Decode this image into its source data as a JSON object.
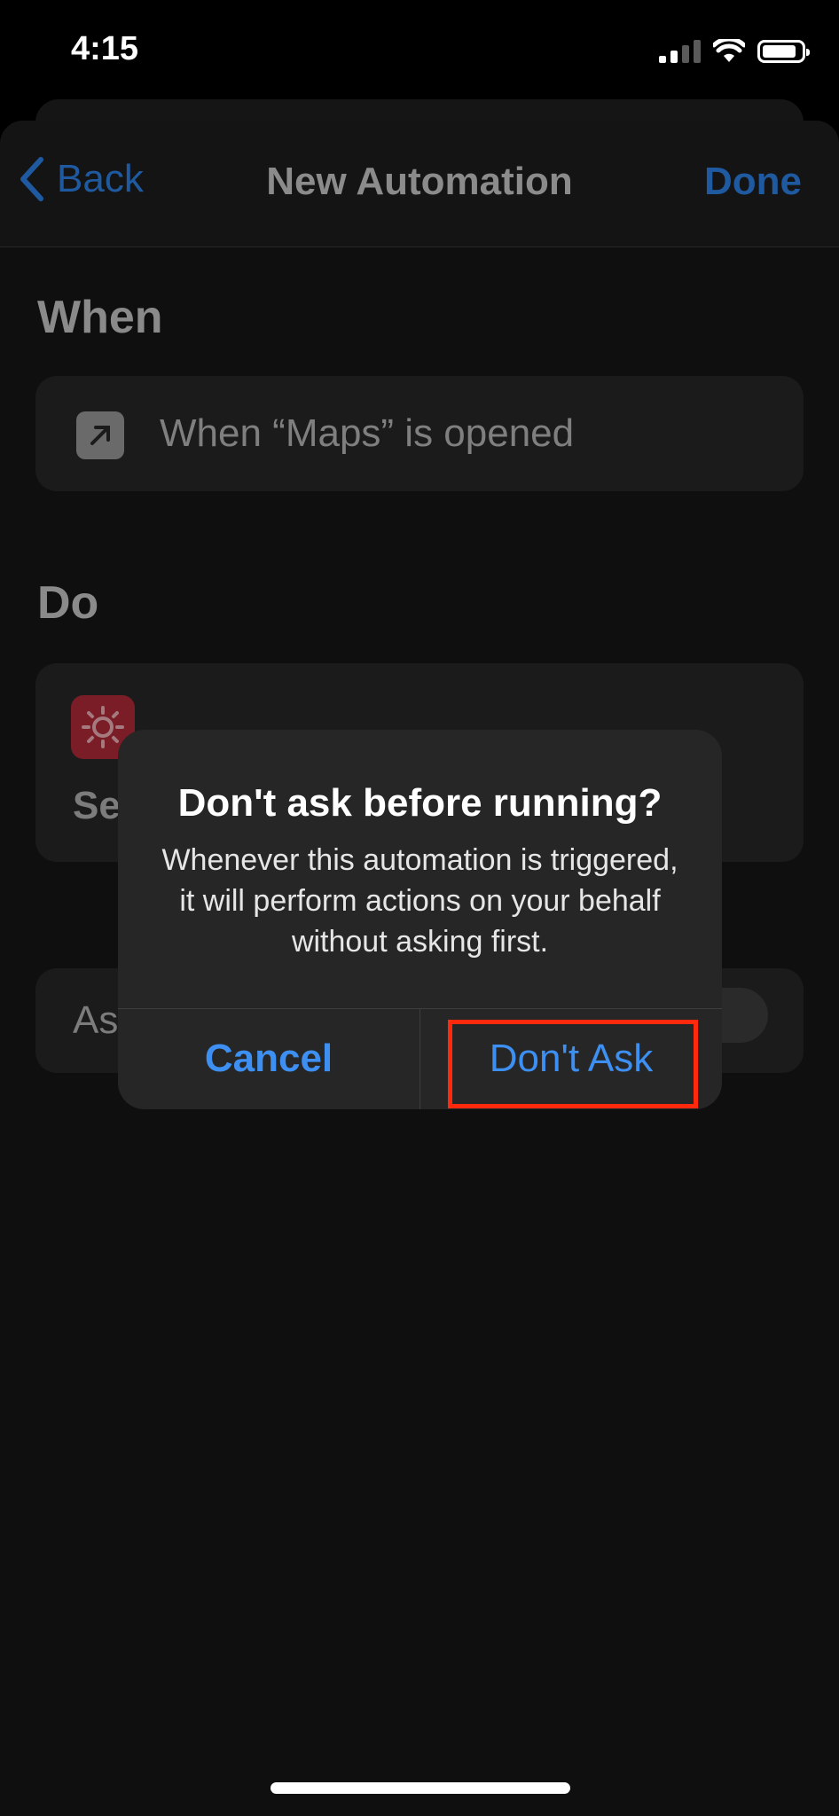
{
  "status_bar": {
    "time": "4:15"
  },
  "nav": {
    "back_label": "Back",
    "title": "New Automation",
    "done_label": "Done"
  },
  "when_section": {
    "heading": "When",
    "trigger_text": "When “Maps” is opened"
  },
  "do_section": {
    "heading": "Do",
    "action_label_visible": "Se"
  },
  "ask_section": {
    "label_visible": "As"
  },
  "dialog": {
    "title": "Don't ask before running?",
    "message": "Whenever this automation is triggered, it will perform actions on your behalf without asking first.",
    "cancel_label": "Cancel",
    "dont_ask_label": "Don't Ask"
  },
  "colors": {
    "accent_blue": "#3d8ff2",
    "highlight_red": "#ff2a0e",
    "action_icon_red": "#7a1d27"
  }
}
